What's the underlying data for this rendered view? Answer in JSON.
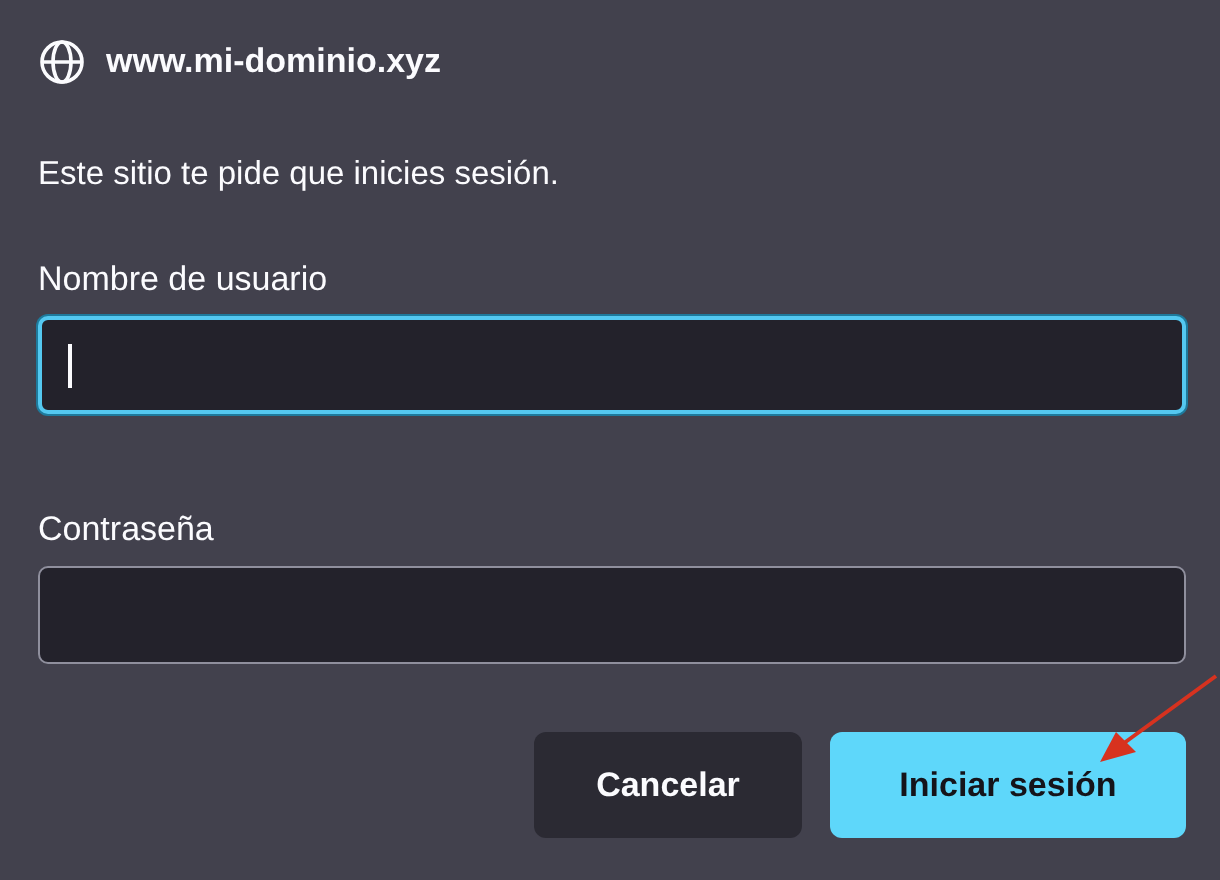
{
  "site": {
    "address": "www.mi-dominio.xyz"
  },
  "message": "Este sitio te pide que inicies sesión.",
  "fields": [
    {
      "label": "Nombre de usuario",
      "focused": true
    },
    {
      "label": "Contraseña",
      "focused": false
    }
  ],
  "buttons": [
    {
      "label": "Cancelar",
      "kind": "secondary"
    },
    {
      "label": "Iniciar sesión",
      "kind": "primary"
    }
  ]
}
